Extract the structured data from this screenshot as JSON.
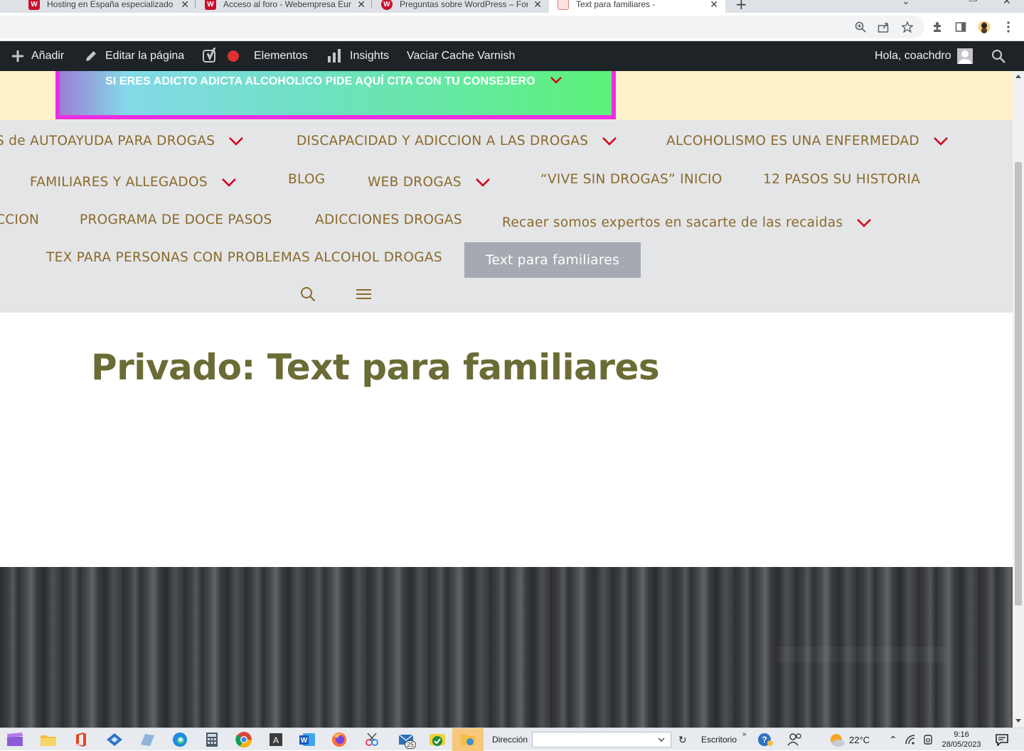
{
  "browser": {
    "tabs": [
      {
        "title": "Hosting en España especializado",
        "favicon_color": "#c8102e",
        "active": false
      },
      {
        "title": "Acceso al foro - Webempresa Eur",
        "favicon_color": "#c8102e",
        "active": false
      },
      {
        "title": "Preguntas sobre WordPress – For",
        "favicon_color": "#c8102e",
        "active": false
      },
      {
        "title": "Text para familiares -",
        "favicon_color": "#e37b7b",
        "active": true
      }
    ],
    "close_glyph": "✕",
    "new_tab_glyph": "+"
  },
  "adminbar": {
    "add_label": "Añadir",
    "edit_label": "Editar la página",
    "elements_label": "Elementos",
    "insights_label": "Insights",
    "varnish_label": "Vaciar Cache Varnish",
    "greeting": "Hola, coachdro"
  },
  "site": {
    "banner_text": "SI ERES ADICTO ADICTA ALCOHOLICO PIDE AQUÍ CITA CON TU CONSEJERO",
    "nav": {
      "row1": [
        {
          "label": "S de AUTOAYUDA PARA DROGAS",
          "dropdown": true
        },
        {
          "label": "DISCAPACIDAD Y ADICCION A LAS DROGAS",
          "dropdown": true
        },
        {
          "label": "ALCOHOLISMO ES UNA ENFERMEDAD",
          "dropdown": true
        }
      ],
      "row2": [
        {
          "label": "FAMILIARES Y ALLEGADOS",
          "dropdown": true
        },
        {
          "label": "BLOG",
          "dropdown": false
        },
        {
          "label": "WEB DROGAS",
          "dropdown": true
        },
        {
          "label": "“VIVE SIN DROGAS” INICIO",
          "dropdown": false
        },
        {
          "label": "12 PASOS SU HISTORIA",
          "dropdown": false
        }
      ],
      "row3": [
        {
          "label": "CCION",
          "dropdown": false
        },
        {
          "label": "PROGRAMA DE DOCE PASOS",
          "dropdown": false
        },
        {
          "label": "ADICCIONES DROGAS",
          "dropdown": false
        },
        {
          "label": "Recaer somos expertos en sacarte de las recaidas",
          "dropdown": true
        }
      ],
      "row4": [
        {
          "label": "TEX PARA PERSONAS CON PROBLEMAS ALCOHOL DROGAS",
          "dropdown": false
        },
        {
          "label": "Text para familiares",
          "dropdown": false,
          "current": true
        }
      ]
    },
    "page_title": "Privado: Text para familiares",
    "colors": {
      "nav_text": "#8b6a2b",
      "chevron": "#d0021b",
      "title": "#6b6b35"
    }
  },
  "taskbar": {
    "address_label": "Dirección",
    "desktop_label": "Escritorio",
    "mail_badge": "25",
    "weather": "22°C",
    "time": "9:16",
    "date": "28/05/2023"
  }
}
